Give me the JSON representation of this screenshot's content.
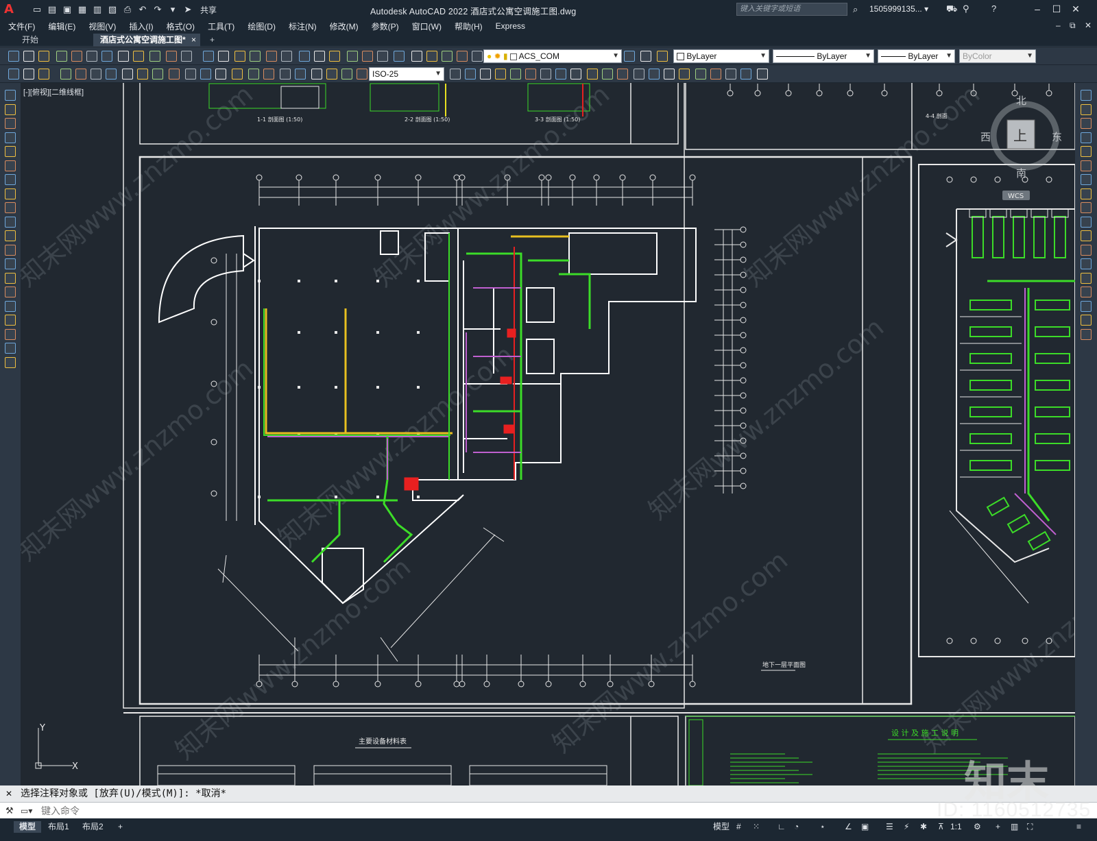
{
  "app": {
    "logo_letter": "A",
    "title": "Autodesk AutoCAD 2022    酒店式公寓空调施工图.dwg",
    "share_label": "共享",
    "search_placeholder": "键入关键字或短语",
    "user": "1505999135... ▾"
  },
  "menu": [
    "文件(F)",
    "编辑(E)",
    "视图(V)",
    "插入(I)",
    "格式(O)",
    "工具(T)",
    "绘图(D)",
    "标注(N)",
    "修改(M)",
    "参数(P)",
    "窗口(W)",
    "帮助(H)",
    "Express"
  ],
  "tabs": {
    "start": "开始",
    "active": "酒店式公寓空调施工图*",
    "close": "×",
    "new": "+"
  },
  "toolbar": {
    "layer": "ACS_COM",
    "color": "ByLayer",
    "linetype": "ByLayer",
    "lineweight": "ByLayer",
    "plotstyle": "ByColor",
    "dimstyle": "ISO-25"
  },
  "viewport": {
    "label": "[-][俯视][二维线框]",
    "viewcube": {
      "north": "北",
      "south": "南",
      "east": "东",
      "west": "西",
      "top": "上",
      "wcs": "WCS"
    },
    "ucs": {
      "x": "X",
      "y": "Y"
    },
    "drawing_texts": {
      "section1": "1-1 剖面图 (1:50)",
      "section2": "2-2 剖面图 (1:50)",
      "section3": "3-3 剖面图 (1:50)",
      "section4": "4-4 剖面",
      "plan_title": "地下一层平面图",
      "materials_title": "主要设备材料表",
      "notes_title": "设 计 及 施 工 说 明"
    },
    "watermark": "知末网www.znzmo.com"
  },
  "command": {
    "history": "选择注释对象或 [放弃(U)/模式(M)]: *取消*",
    "placeholder": "键入命令"
  },
  "status": {
    "layouts": [
      "模型",
      "布局1",
      "布局2"
    ],
    "add_layout": "+",
    "model_label": "模型",
    "scale": "1:1"
  },
  "watermark_id": "ID: 1160512735",
  "watermark_logo": "知末",
  "colors": {
    "background": "#212830",
    "panel": "#2d3845",
    "titlebar": "#1c2732",
    "duct_green": "#3cdc28",
    "duct_purple": "#c060d0",
    "duct_red": "#e82020",
    "wall": "#ffffff"
  }
}
